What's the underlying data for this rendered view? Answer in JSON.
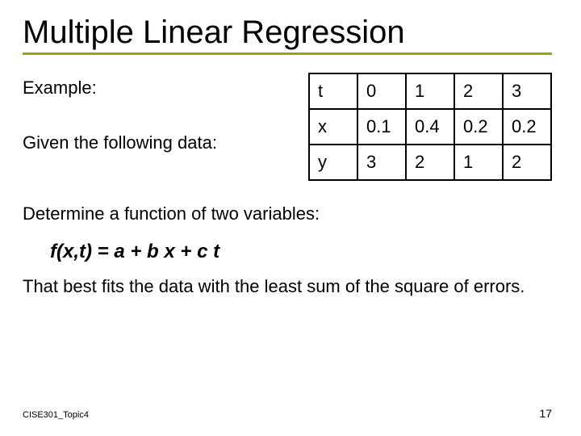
{
  "title": "Multiple Linear Regression",
  "example_label": "Example:",
  "given_label": "Given the following data:",
  "table": {
    "rows": [
      {
        "head": "t",
        "c1": "0",
        "c2": "1",
        "c3": "2",
        "c4": "3"
      },
      {
        "head": "x",
        "c1": "0.1",
        "c2": "0.4",
        "c3": "0.2",
        "c4": "0.2"
      },
      {
        "head": "y",
        "c1": "3",
        "c2": "2",
        "c3": "1",
        "c4": "2"
      }
    ]
  },
  "determine_label": "Determine a function of two variables:",
  "formula": "f(x,t) = a + b x + c t",
  "fit_label": "That best fits the data with the least sum of the square of errors.",
  "footer_left": "CISE301_Topic4",
  "footer_right": "17",
  "chart_data": {
    "type": "table",
    "title": "Given data for multiple linear regression",
    "columns": [
      "t",
      "x",
      "y"
    ],
    "rows": [
      {
        "t": 0,
        "x": 0.1,
        "y": 3
      },
      {
        "t": 1,
        "x": 0.4,
        "y": 2
      },
      {
        "t": 2,
        "x": 0.2,
        "y": 1
      },
      {
        "t": 3,
        "x": 0.2,
        "y": 2
      }
    ]
  }
}
